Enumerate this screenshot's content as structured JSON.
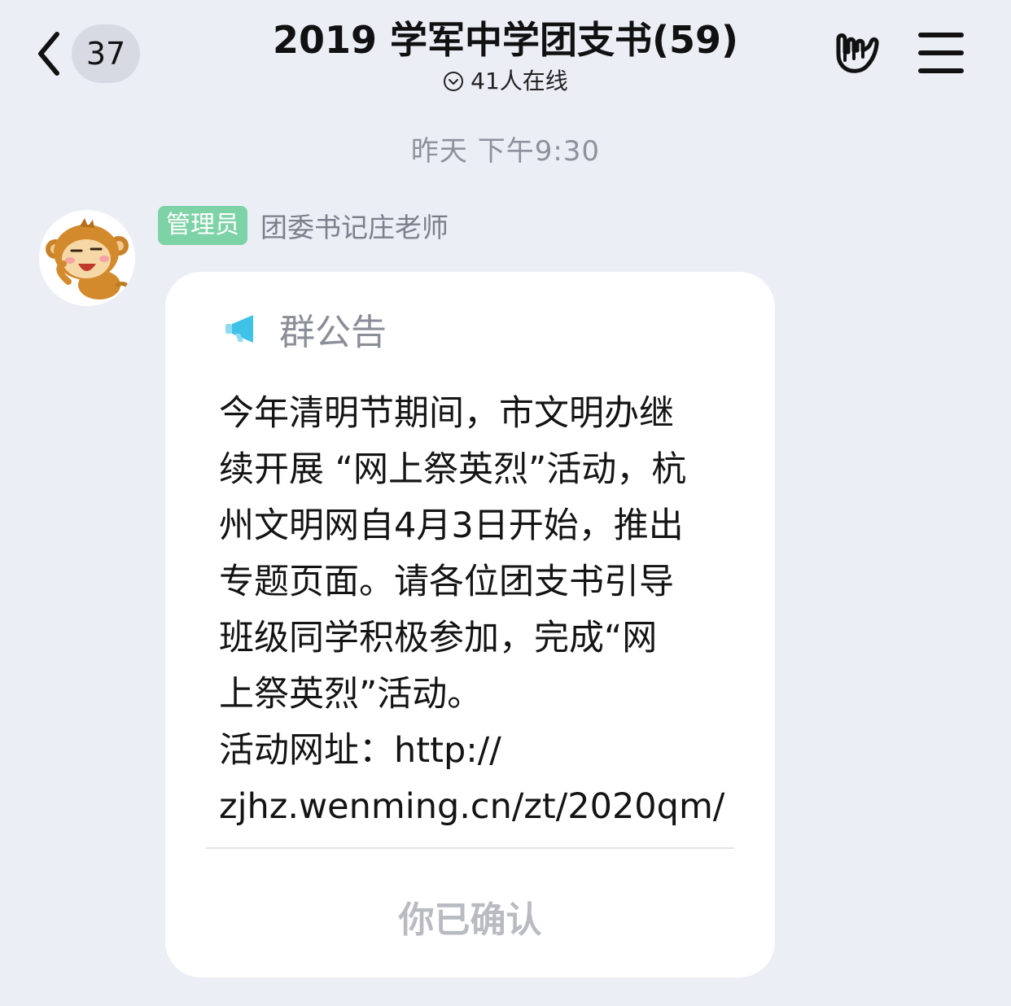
{
  "header": {
    "unread_count": "37",
    "title": "2019 学军中学团支书(59)",
    "online_text": "41人在线"
  },
  "timestamp": "昨天 下午9:30",
  "message": {
    "admin_badge": "管理员",
    "sender_name": "团委书记庄老师",
    "notice": {
      "title": "群公告",
      "lines": [
        "今年清明节期间，市文明办继",
        "续开展 “网上祭英烈”活动，杭",
        "州文明网自4月3日开始，推出",
        "专题页面。请各位团支书引导",
        "班级同学积极参加，完成“网",
        "上祭英烈”活动。",
        "活动网址：http://",
        "zjhz.wenming.cn/zt/2020qm/"
      ],
      "confirm_label": "你已确认"
    }
  },
  "icons": {
    "back": "chevron-left-icon",
    "online": "chevron-down-circle-icon",
    "hand": "rock-hand-icon",
    "menu": "menu-icon",
    "megaphone": "megaphone-icon"
  },
  "colors": {
    "background": "#eceef6",
    "admin_badge": "#7dd3a6",
    "megaphone": "#3fc2e8"
  }
}
